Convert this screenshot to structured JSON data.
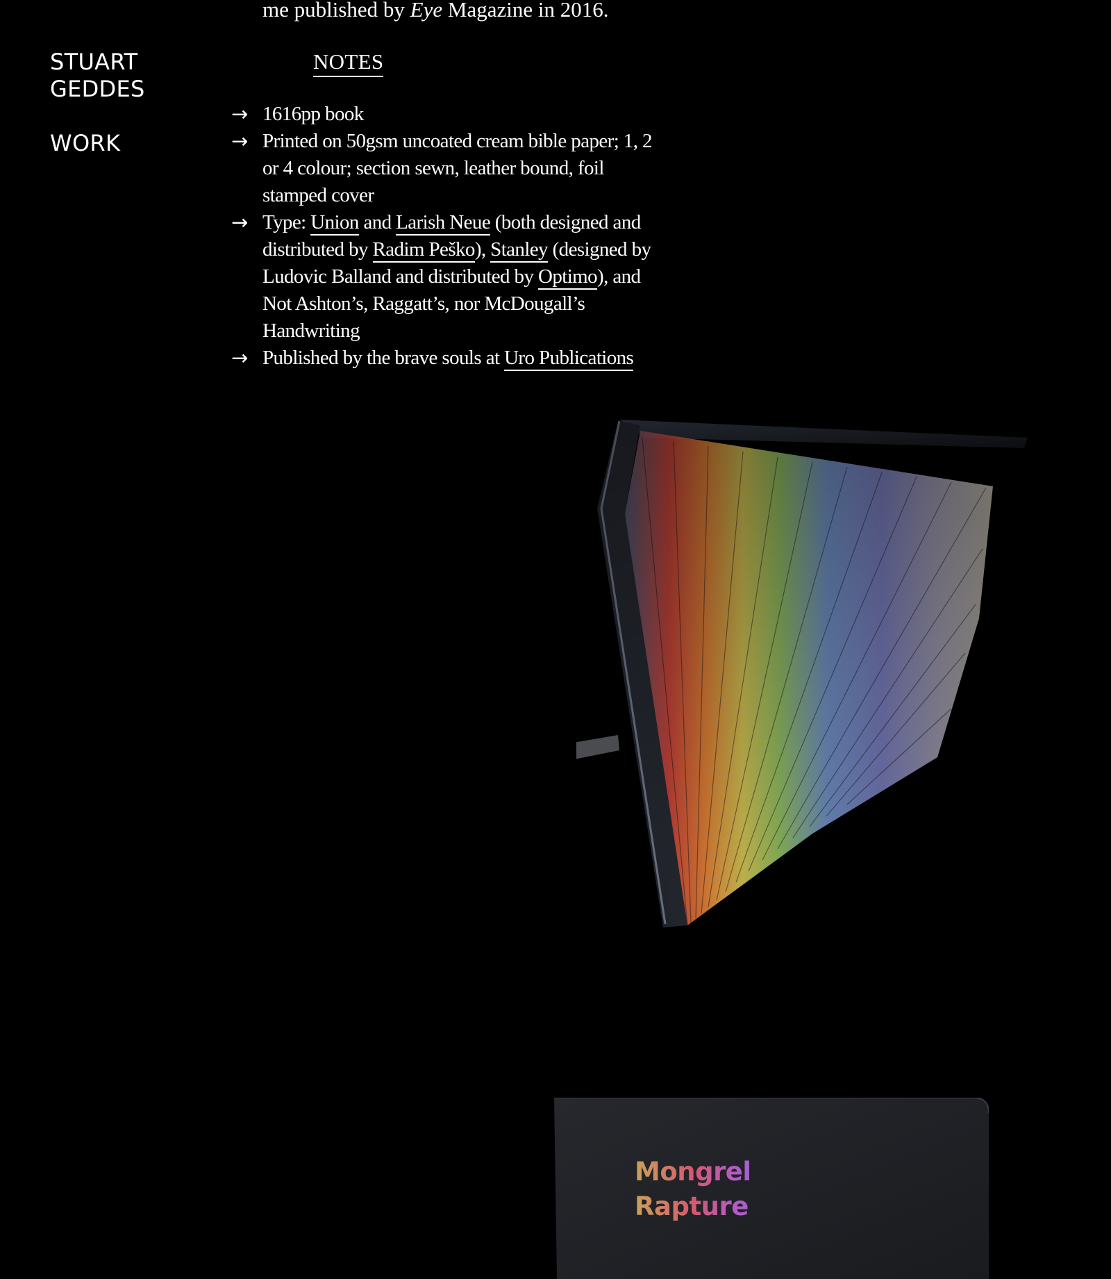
{
  "nav": {
    "site_name": "STUART GEDDES",
    "work_label": "WORK"
  },
  "main": {
    "intro_prefix": "me published by ",
    "intro_italic": "Eye",
    "intro_suffix": " Magazine in 2016.",
    "notes_heading": "NOTES",
    "arrow": "→",
    "notes": {
      "n1": "1616pp book",
      "n2": "Printed on 50gsm uncoated cream bible paper; 1, 2 or 4 colour; section sewn, leather bound, foil stamped cover",
      "n3": {
        "t1": "Type: ",
        "link_union": "Union",
        "t2": " and ",
        "link_larish": "Larish Neue",
        "t3": " (both designed and distributed by ",
        "link_radim": "Radim Peško",
        "t4": "), ",
        "link_stanley": "Stanley",
        "t5": " (designed by Ludovic Balland and distributed by ",
        "link_optimo": "Optimo",
        "t6": "), and Not Ashton’s, Raggatt’s, nor McDougall’s Handwriting"
      },
      "n4": {
        "t1": "Published by the brave souls at ",
        "link_uro": "Uro Publications"
      }
    }
  },
  "cover": {
    "title_line1": "Mongrel",
    "title_line2": "Rapture"
  },
  "colors": {
    "background": "#000000",
    "text": "#ffffff"
  }
}
